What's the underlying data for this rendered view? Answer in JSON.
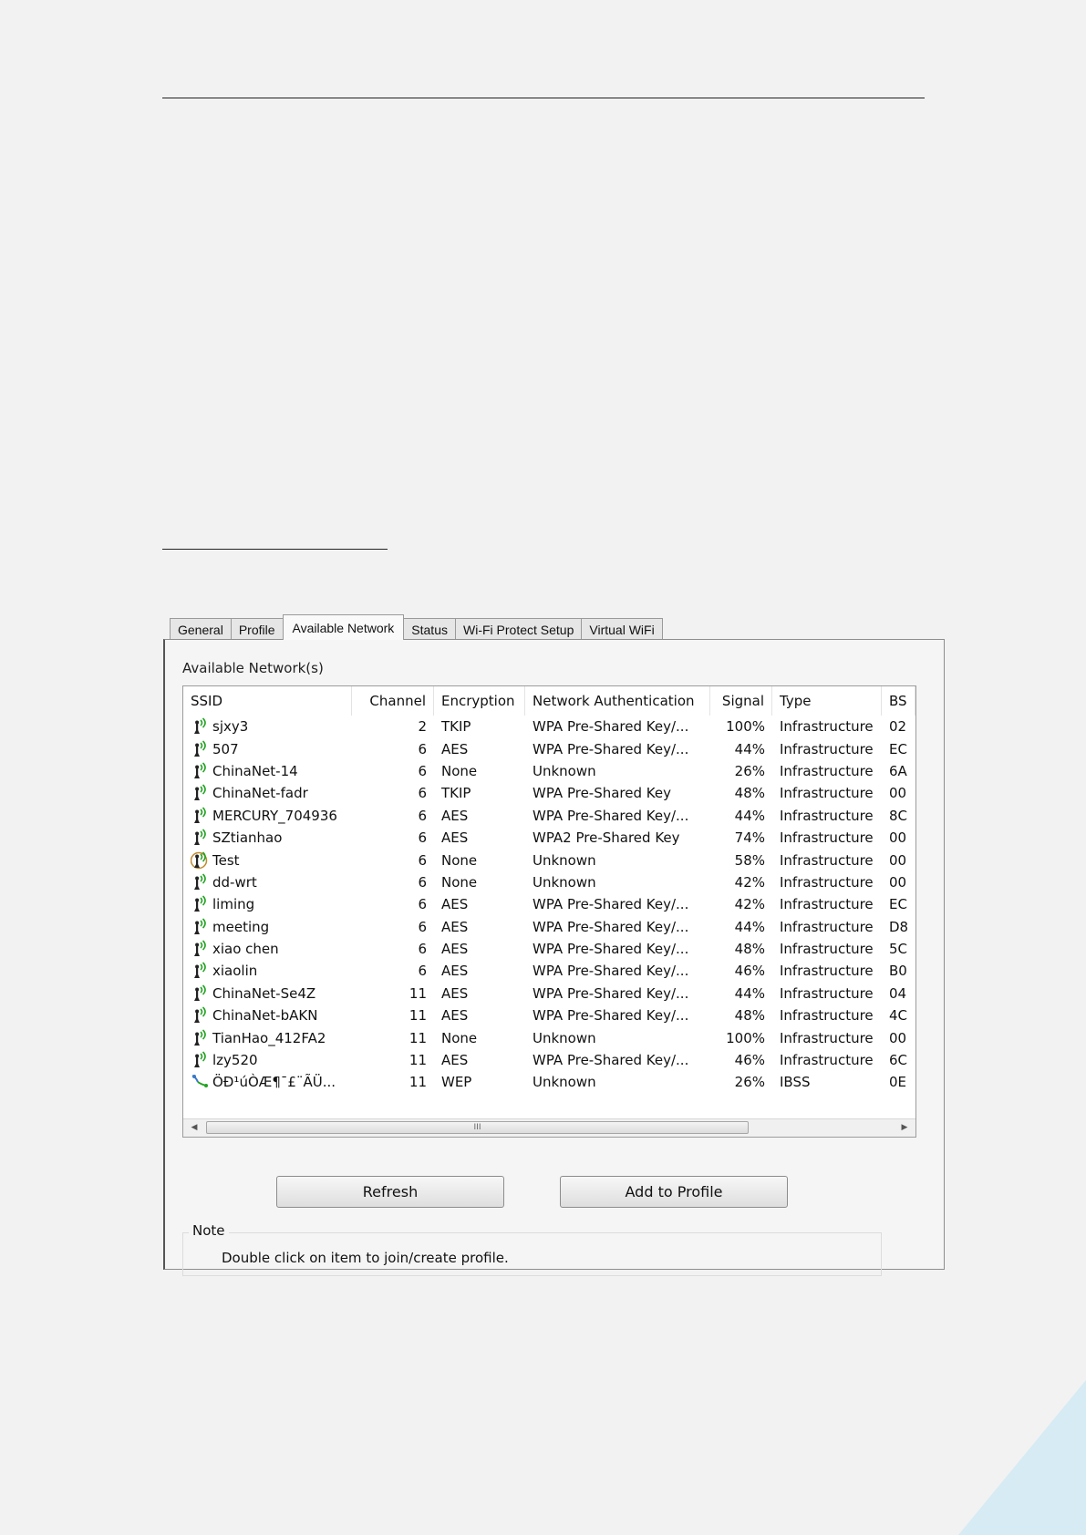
{
  "tabs": [
    "General",
    "Profile",
    "Available Network",
    "Status",
    "Wi-Fi Protect Setup",
    "Virtual WiFi"
  ],
  "active_tab_index": 2,
  "panel_title": "Available Network(s)",
  "columns": [
    "SSID",
    "Channel",
    "Encryption",
    "Network Authentication",
    "Signal",
    "Type",
    "BS"
  ],
  "networks": [
    {
      "ssid": "sjxy3",
      "channel": "2",
      "encryption": "TKIP",
      "auth": "WPA Pre-Shared Key/...",
      "signal": "100%",
      "type": "Infrastructure",
      "bssid": "02",
      "icon": "antenna-signal-icon"
    },
    {
      "ssid": "507",
      "channel": "6",
      "encryption": "AES",
      "auth": "WPA Pre-Shared Key/...",
      "signal": "44%",
      "type": "Infrastructure",
      "bssid": "EC",
      "icon": "antenna-signal-icon"
    },
    {
      "ssid": "ChinaNet-14",
      "channel": "6",
      "encryption": "None",
      "auth": "Unknown",
      "signal": "26%",
      "type": "Infrastructure",
      "bssid": "6A",
      "icon": "antenna-signal-icon"
    },
    {
      "ssid": "ChinaNet-fadr",
      "channel": "6",
      "encryption": "TKIP",
      "auth": "WPA Pre-Shared Key",
      "signal": "48%",
      "type": "Infrastructure",
      "bssid": "00",
      "icon": "antenna-signal-icon"
    },
    {
      "ssid": "MERCURY_704936",
      "channel": "6",
      "encryption": "AES",
      "auth": "WPA Pre-Shared Key/...",
      "signal": "44%",
      "type": "Infrastructure",
      "bssid": "8C",
      "icon": "antenna-signal-icon"
    },
    {
      "ssid": "SZtianhao",
      "channel": "6",
      "encryption": "AES",
      "auth": "WPA2 Pre-Shared Key",
      "signal": "74%",
      "type": "Infrastructure",
      "bssid": "00",
      "icon": "antenna-signal-icon"
    },
    {
      "ssid": "Test",
      "channel": "6",
      "encryption": "None",
      "auth": "Unknown",
      "signal": "58%",
      "type": "Infrastructure",
      "bssid": "00",
      "icon": "antenna-connected-icon"
    },
    {
      "ssid": "dd-wrt",
      "channel": "6",
      "encryption": "None",
      "auth": "Unknown",
      "signal": "42%",
      "type": "Infrastructure",
      "bssid": "00",
      "icon": "antenna-signal-icon"
    },
    {
      "ssid": "liming",
      "channel": "6",
      "encryption": "AES",
      "auth": "WPA Pre-Shared Key/...",
      "signal": "42%",
      "type": "Infrastructure",
      "bssid": "EC",
      "icon": "antenna-signal-icon"
    },
    {
      "ssid": "meeting",
      "channel": "6",
      "encryption": "AES",
      "auth": "WPA Pre-Shared Key/...",
      "signal": "44%",
      "type": "Infrastructure",
      "bssid": "D8",
      "icon": "antenna-signal-icon"
    },
    {
      "ssid": "xiao chen",
      "channel": "6",
      "encryption": "AES",
      "auth": "WPA Pre-Shared Key/...",
      "signal": "48%",
      "type": "Infrastructure",
      "bssid": "5C",
      "icon": "antenna-signal-icon"
    },
    {
      "ssid": "xiaolin",
      "channel": "6",
      "encryption": "AES",
      "auth": "WPA Pre-Shared Key/...",
      "signal": "46%",
      "type": "Infrastructure",
      "bssid": "B0",
      "icon": "antenna-signal-icon"
    },
    {
      "ssid": "ChinaNet-Se4Z",
      "channel": "11",
      "encryption": "AES",
      "auth": "WPA Pre-Shared Key/...",
      "signal": "44%",
      "type": "Infrastructure",
      "bssid": "04",
      "icon": "antenna-signal-icon"
    },
    {
      "ssid": "ChinaNet-bAKN",
      "channel": "11",
      "encryption": "AES",
      "auth": "WPA Pre-Shared Key/...",
      "signal": "48%",
      "type": "Infrastructure",
      "bssid": "4C",
      "icon": "antenna-signal-icon"
    },
    {
      "ssid": "TianHao_412FA2",
      "channel": "11",
      "encryption": "None",
      "auth": "Unknown",
      "signal": "100%",
      "type": "Infrastructure",
      "bssid": "00",
      "icon": "antenna-signal-icon"
    },
    {
      "ssid": "lzy520",
      "channel": "11",
      "encryption": "AES",
      "auth": "WPA Pre-Shared Key/...",
      "signal": "46%",
      "type": "Infrastructure",
      "bssid": "6C",
      "icon": "antenna-signal-icon"
    },
    {
      "ssid": "ÖÐ¹úÒÆ¶¯£¨ÃÜ...",
      "channel": "11",
      "encryption": "WEP",
      "auth": "Unknown",
      "signal": "26%",
      "type": "IBSS",
      "bssid": "0E",
      "icon": "adhoc-network-icon"
    }
  ],
  "scrollbar_grip": "III",
  "buttons": {
    "refresh": "Refresh",
    "add_to_profile": "Add to Profile"
  },
  "note": {
    "legend": "Note",
    "text": "Double click on item to join/create profile."
  },
  "colors": {
    "signal_green": "#22a322",
    "connected_ring": "#c08a2a",
    "adhoc_blue": "#3a78c8"
  }
}
